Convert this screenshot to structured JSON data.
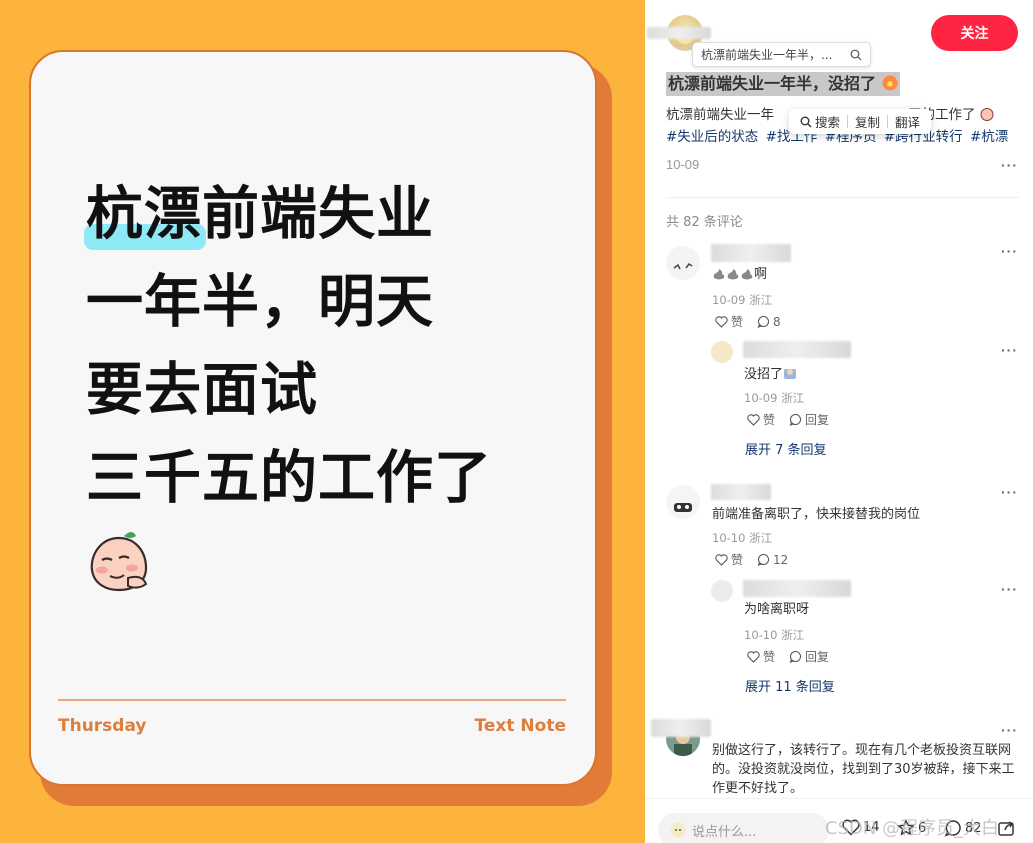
{
  "image": {
    "headline_highlight": "杭漂",
    "headline_lines": [
      "前端失业",
      "一年半，明天",
      "要去面试",
      "三千五的工作了"
    ],
    "footer_left": "Thursday",
    "footer_right": "Text Note",
    "colors": {
      "background": "#FDB43C",
      "card": "#F7F7F7",
      "accent": "#DB7E3E",
      "highlight": "#8EE8F5"
    }
  },
  "note": {
    "follow_label": "关注",
    "search_tip": "杭漂前端失业一年半，...",
    "title": "杭漂前端失业一年半，没招了",
    "desc_start": "杭漂前端失业一年",
    "desc_end": "五的工作了",
    "tags": [
      "#失业后的状态",
      "#找工作",
      "#程序员",
      "#跨行业转行",
      "#杭漂"
    ],
    "selection_menu": {
      "search": "搜索",
      "copy": "复制",
      "translate": "翻译"
    },
    "date": "10-09",
    "comment_count": "共 82 条评论"
  },
  "comments": [
    {
      "text_suffix": "啊",
      "meta": "10-09 浙江",
      "like_label": "赞",
      "reply_count": "8",
      "reply": {
        "text": "没招了",
        "meta": "10-09 浙江",
        "like_label": "赞",
        "reply_label": "回复"
      },
      "expand": "展开 7 条回复"
    },
    {
      "text": "前端准备离职了，快来接替我的岗位",
      "meta": "10-10 浙江",
      "like_label": "赞",
      "reply_count": "12",
      "reply": {
        "text": "为啥离职呀",
        "meta": "10-10 浙江",
        "like_label": "赞",
        "reply_label": "回复"
      },
      "expand": "展开 11 条回复"
    },
    {
      "text_line1": "别做这行了，该转行了。现在有几个老板投资互联网",
      "text_line2": "的。没投资就没岗位，找到到了30岁被辞，接下来工",
      "text_line3": "作更不好找了。"
    }
  ],
  "bottom": {
    "input_placeholder": "说点什么...",
    "likes": "14",
    "stars": "6",
    "comments": "82",
    "watermark": "CSDN @程序员_大白"
  }
}
